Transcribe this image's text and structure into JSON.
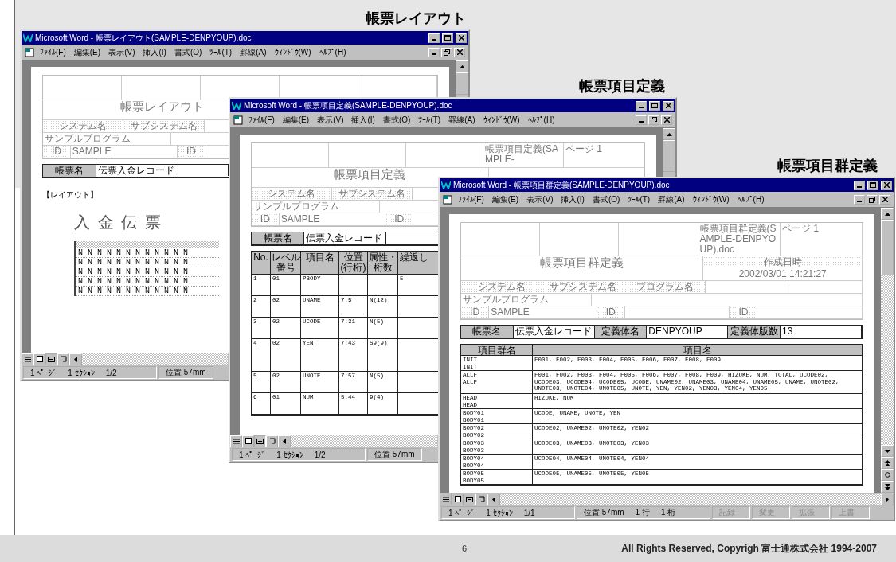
{
  "windows": [
    {
      "caption": "帳票レイアウト",
      "title": "Microsoft Word - 帳票レイアウト(SAMPLE-DENPYOUP).doc",
      "menu": [
        "ﾌｧｲﾙ(F)",
        "編集(E)",
        "表示(V)",
        "挿入(I)",
        "書式(O)",
        "ﾂｰﾙ(T)",
        "罫線(A)",
        "ｳｨﾝﾄﾞｳ(W)",
        "ﾍﾙﾌﾟ(H)"
      ],
      "document": {
        "kind": "layout",
        "header": {
          "title": "帳票レイアウト",
          "labels": [
            "システム名",
            "サブシステム名"
          ],
          "program": "サンプルプログラム",
          "ids": [
            {
              "label": "ID",
              "value": "SAMPLE"
            },
            {
              "label": "ID"
            }
          ]
        },
        "record_bar": [
          {
            "text": "帳票名",
            "kind": "label"
          },
          {
            "text": "伝票入金レコード",
            "kind": "value"
          }
        ],
        "section": "【レイアウト】",
        "form_title": "入 金 伝 票",
        "grid_rows": [
          "N N N N N N N N N N N N",
          "N N N N N N N N N N N N",
          "N N N N N N N N N N N N",
          "N N N N N N N N N N N N",
          "N N N N N N N N N N N N"
        ]
      },
      "status": [
        {
          "items": [
            "1 ﾍﾟｰｼﾞ",
            "1 ｾｸｼｮﾝ",
            "1/2"
          ],
          "disabled": false
        },
        {
          "items": [
            "位置 57mm"
          ],
          "disabled": false
        }
      ]
    },
    {
      "caption": "帳票項目定義",
      "title": "Microsoft Word - 帳票項目定義(SAMPLE-DENPYOUP).doc",
      "menu": [
        "ﾌｧｲﾙ(F)",
        "編集(E)",
        "表示(V)",
        "挿入(I)",
        "書式(O)",
        "ﾂｰﾙ(T)",
        "罫線(A)",
        "ｳｨﾝﾄﾞｳ(W)",
        "ﾍﾙﾌﾟ(H)"
      ],
      "document": {
        "kind": "item_table",
        "header": {
          "title": "帳票項目定義",
          "top": [
            "帳票項目定義(SAMPLE-",
            "ページ 1"
          ],
          "labels": [
            "システム名",
            "サブシステム名"
          ],
          "program": "サンプルプログラム",
          "ids": [
            {
              "label": "ID",
              "value": "SAMPLE"
            },
            {
              "label": "ID"
            }
          ]
        },
        "record_bar": [
          {
            "text": "帳票名",
            "kind": "label"
          },
          {
            "text": "伝票入金レコード",
            "kind": "value"
          }
        ],
        "columns": [
          "No.",
          "レベル番号",
          "項目名",
          "位置(行桁)",
          "属性・桁数",
          "繰返し"
        ],
        "rows": [
          {
            "no": "1",
            "level": "01",
            "name": "PBODY",
            "repeat": "5",
            "tall": false
          },
          {
            "no": "2",
            "level": "02",
            "name": "UNAME",
            "position": "7:5",
            "attr": "N(12)",
            "tall": false
          },
          {
            "no": "3",
            "level": "02",
            "name": "UCODE",
            "position": "7:31",
            "attr": "N(5)",
            "tall": false
          },
          {
            "no": "4",
            "level": "02",
            "name": "YEN",
            "position": "7:43",
            "attr": "S9(9)",
            "tall": true
          },
          {
            "no": "5",
            "level": "02",
            "name": "UNOTE",
            "position": "7:57",
            "attr": "N(5)",
            "tall": false
          },
          {
            "no": "6",
            "level": "01",
            "name": "NUM",
            "position": "5:44",
            "attr": "9(4)",
            "tall": false
          }
        ]
      },
      "status": [
        {
          "items": [
            "1 ﾍﾟｰｼﾞ",
            "1 ｾｸｼｮﾝ",
            "1/2"
          ],
          "disabled": false
        },
        {
          "items": [
            "位置 57mm"
          ],
          "disabled": false
        }
      ]
    },
    {
      "caption": "帳票項目群定義",
      "title": "Microsoft Word - 帳票項目群定義(SAMPLE-DENPYOUP).doc",
      "menu": [
        "ﾌｧｲﾙ(F)",
        "編集(E)",
        "表示(V)",
        "挿入(I)",
        "書式(O)",
        "ﾂｰﾙ(T)",
        "罫線(A)",
        "ｳｨﾝﾄﾞｳ(W)",
        "ﾍﾙﾌﾟ(H)"
      ],
      "document": {
        "kind": "group_table",
        "header": {
          "title": "帳票項目群定義",
          "top": [
            "帳票項目群定義(SAMPLE-DENPYOUP).doc",
            "ページ 1"
          ],
          "side": [
            "作成日時",
            "2002/03/01 14:21:27"
          ],
          "labels": [
            "システム名",
            "サブシステム名",
            "プログラム名"
          ],
          "program": "サンプルプログラム",
          "ids": [
            {
              "label": "ID",
              "value": "SAMPLE"
            },
            {
              "label": "ID"
            },
            {
              "label": "ID"
            }
          ]
        },
        "record_bar": [
          {
            "text": "帳票名",
            "kind": "label"
          },
          {
            "text": "伝票入金レコード",
            "kind": "value"
          },
          {
            "text": "定義体名",
            "kind": "label"
          },
          {
            "text": "DENPYOUP",
            "kind": "value"
          },
          {
            "text": "定義体版数",
            "kind": "label"
          },
          {
            "text": "13",
            "kind": "value"
          }
        ],
        "columns": [
          "項目群名",
          "項目名"
        ],
        "rows": [
          {
            "names": [
              "INIT",
              "INIT"
            ],
            "items": "F001, F002, F003, F004, F005, F006, F007, F008, F009"
          },
          {
            "names": [
              "ALLF",
              "ALLF"
            ],
            "items": "F001, F002, F003, F004, F005, F006, F007, F008, F009, HIZUKE, NUM, TOTAL, UCODE02, UCODE03, UCODE04, UCODE05, UCODE, UNAME02, UNAME03, UNAME04, UNAME05, UNAME, UNOTE02, UNOTE03, UNOTE04, UNOTE05, UNOTE, YEN, YEN02, YEN03, YEN04, YEN05"
          },
          {
            "names": [
              "HEAD",
              "HEAD"
            ],
            "items": "HIZUKE, NUM"
          },
          {
            "names": [
              "BODY01",
              "BODY01"
            ],
            "items": "UCODE, UNAME, UNOTE, YEN"
          },
          {
            "names": [
              "BODY02",
              "BODY02"
            ],
            "items": "UCODE02, UNAME02, UNOTE02, YEN02"
          },
          {
            "names": [
              "BODY03",
              "BODY03"
            ],
            "items": "UCODE03, UNAME03, UNOTE03, YEN03"
          },
          {
            "names": [
              "BODY04",
              "BODY04"
            ],
            "items": "UCODE04, UNAME04, UNOTE04, YEN04"
          },
          {
            "names": [
              "BODY05",
              "BODY05"
            ],
            "items": "UCODE05, UNAME05, UNOTE05, YEN05"
          }
        ]
      },
      "status": [
        {
          "items": [
            "1 ﾍﾟｰｼﾞ",
            "1 ｾｸｼｮﾝ",
            "1/1"
          ],
          "disabled": false
        },
        {
          "items": [
            "位置 57mm",
            "1 行",
            "1 桁"
          ],
          "disabled": false
        },
        {
          "items": [
            "記録"
          ],
          "disabled": true
        },
        {
          "items": [
            "変更"
          ],
          "disabled": true
        },
        {
          "items": [
            "拡張"
          ],
          "disabled": true
        },
        {
          "items": [
            "上書"
          ],
          "disabled": true
        }
      ]
    }
  ],
  "footer": {
    "page_number": "6",
    "copyright": "All Rights Reserved, Copyrigh 富士通株式会社 1994-2007"
  }
}
